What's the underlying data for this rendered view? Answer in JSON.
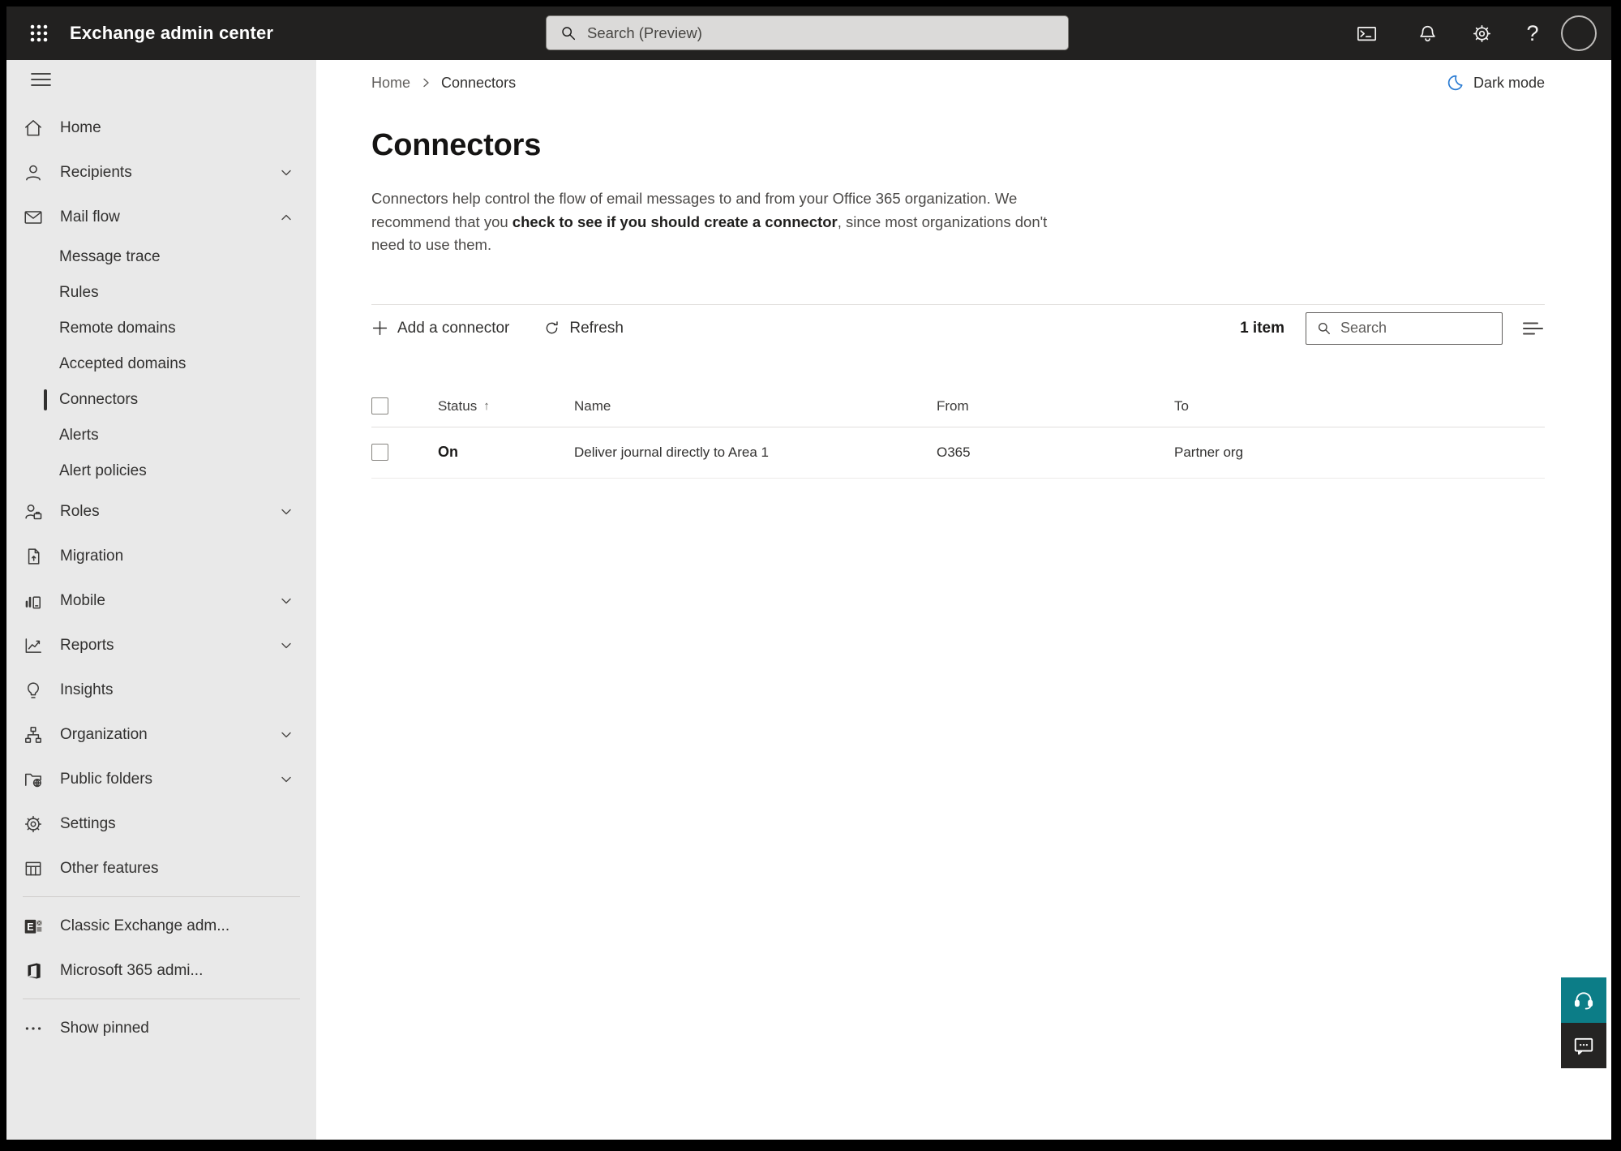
{
  "topbar": {
    "app_title": "Exchange admin center",
    "search_placeholder": "Search (Preview)"
  },
  "sidebar": {
    "items": [
      {
        "label": "Home"
      },
      {
        "label": "Recipients"
      },
      {
        "label": "Mail flow"
      },
      {
        "label": "Message trace"
      },
      {
        "label": "Rules"
      },
      {
        "label": "Remote domains"
      },
      {
        "label": "Accepted domains"
      },
      {
        "label": "Connectors"
      },
      {
        "label": "Alerts"
      },
      {
        "label": "Alert policies"
      },
      {
        "label": "Roles"
      },
      {
        "label": "Migration"
      },
      {
        "label": "Mobile"
      },
      {
        "label": "Reports"
      },
      {
        "label": "Insights"
      },
      {
        "label": "Organization"
      },
      {
        "label": "Public folders"
      },
      {
        "label": "Settings"
      },
      {
        "label": "Other features"
      },
      {
        "label": "Classic Exchange adm..."
      },
      {
        "label": "Microsoft 365 admi..."
      },
      {
        "label": "Show pinned"
      }
    ]
  },
  "breadcrumb": {
    "home": "Home",
    "current": "Connectors"
  },
  "header": {
    "dark_mode_label": "Dark mode"
  },
  "page": {
    "title": "Connectors",
    "desc_line1": "Connectors help control the flow of email messages to and from your Office 365 organization. We",
    "desc_line2_pre": "recommend that you ",
    "desc_line2_link": "check to see if you should create a connector",
    "desc_line2_post": ", since most organizations don't",
    "desc_line3": "need to use them."
  },
  "toolbar": {
    "add_label": "Add a connector",
    "refresh_label": "Refresh",
    "count": "1 item",
    "search_placeholder": "Search"
  },
  "table": {
    "headers": {
      "status": "Status",
      "name": "Name",
      "from": "From",
      "to": "To"
    },
    "sort_arrow": "↑",
    "rows": [
      {
        "status": "On",
        "name": "Deliver journal directly to Area 1",
        "from": "O365",
        "to": "Partner org"
      }
    ]
  },
  "colors": {
    "topbar_bg": "#222120",
    "sidebar_bg": "#e9e9e9",
    "accent_blue": "#2b7cd3",
    "help_teal": "#0c7d87",
    "feedback_dark": "#252423"
  }
}
